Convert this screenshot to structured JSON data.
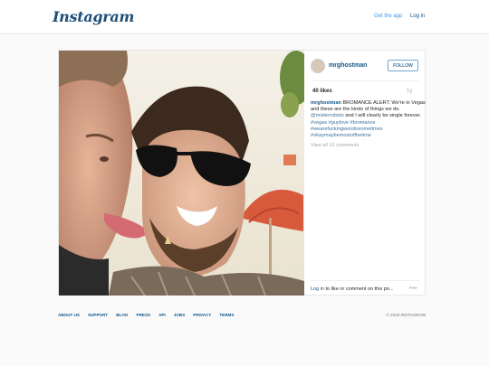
{
  "header": {
    "logo": "Instagram",
    "get_app": "Get the app",
    "login": "Log in"
  },
  "post": {
    "username": "mrghostman",
    "follow_label": "FOLLOW",
    "likes": "40 likes",
    "age": "1y",
    "caption_user": "mrghostman",
    "caption_text": " BROMANCE ALERT: We're in Vegas and these are the kinds of things we do. ",
    "caption_mention": "@misterroboto",
    "caption_text2": " and I will clearly be single forever. ",
    "caption_tags": "#vegas #guylove #bromance #wearefuckingweirdosometimes #okaymaybemostofthetime",
    "view_all": "View all 16 comments",
    "comment_login": "Log in",
    "comment_rest": " to like or comment on this po...",
    "more": "•••"
  },
  "footer": {
    "links": [
      "ABOUT US",
      "SUPPORT",
      "BLOG",
      "PRESS",
      "API",
      "JOBS",
      "PRIVACY",
      "TERMS"
    ],
    "copyright": "© 2015 INSTAGRAM"
  }
}
